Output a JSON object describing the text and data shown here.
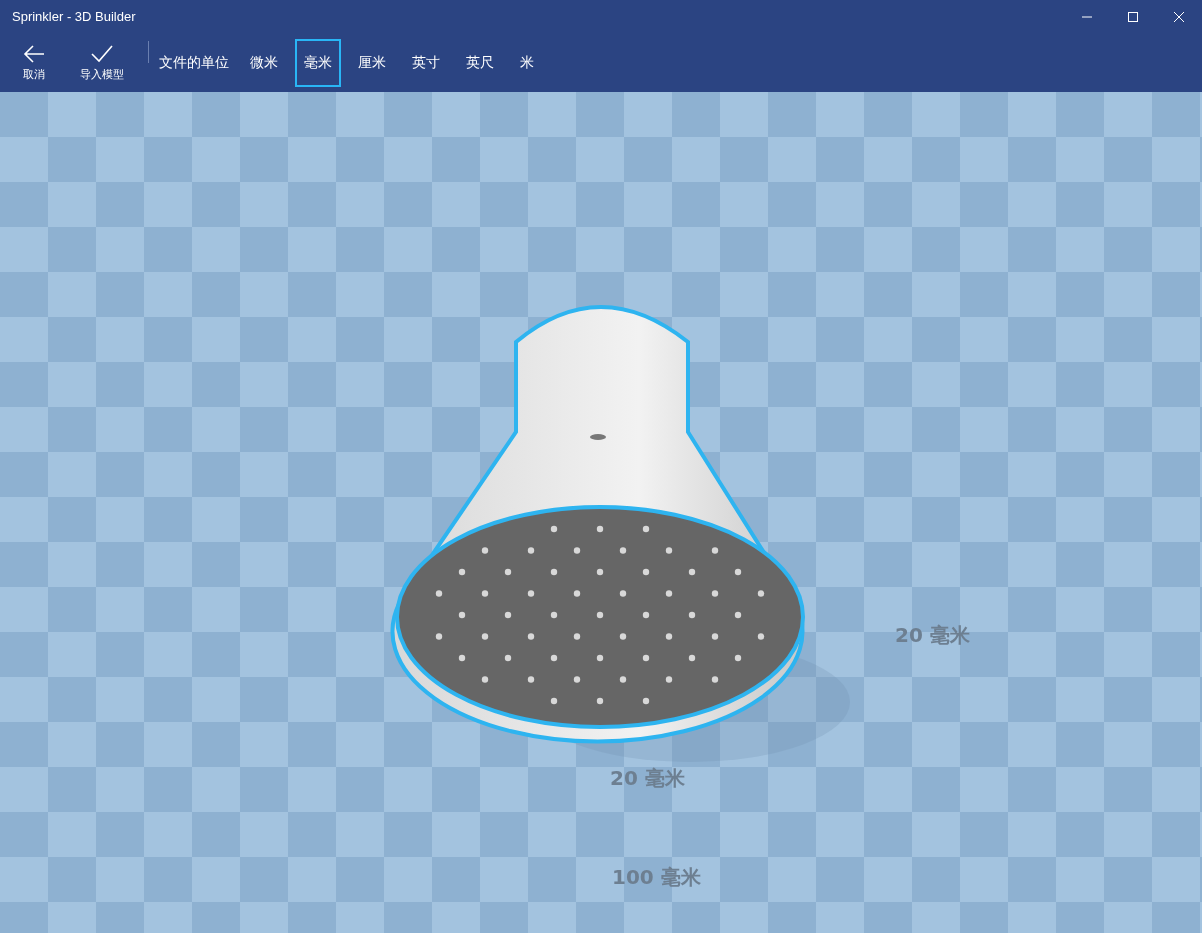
{
  "window": {
    "title": "Sprinkler - 3D Builder"
  },
  "toolbar": {
    "actions": [
      {
        "kind": "back",
        "label": "取消"
      },
      {
        "kind": "confirm",
        "label": "导入模型"
      }
    ],
    "units_label": "文件的单位",
    "units": [
      {
        "label": "微米",
        "selected": false
      },
      {
        "label": "毫米",
        "selected": true
      },
      {
        "label": "厘米",
        "selected": false
      },
      {
        "label": "英寸",
        "selected": false
      },
      {
        "label": "英尺",
        "selected": false
      },
      {
        "label": "米",
        "selected": false
      }
    ]
  },
  "floor_labels": [
    "20 毫米",
    "20 毫米",
    "100 毫米"
  ]
}
